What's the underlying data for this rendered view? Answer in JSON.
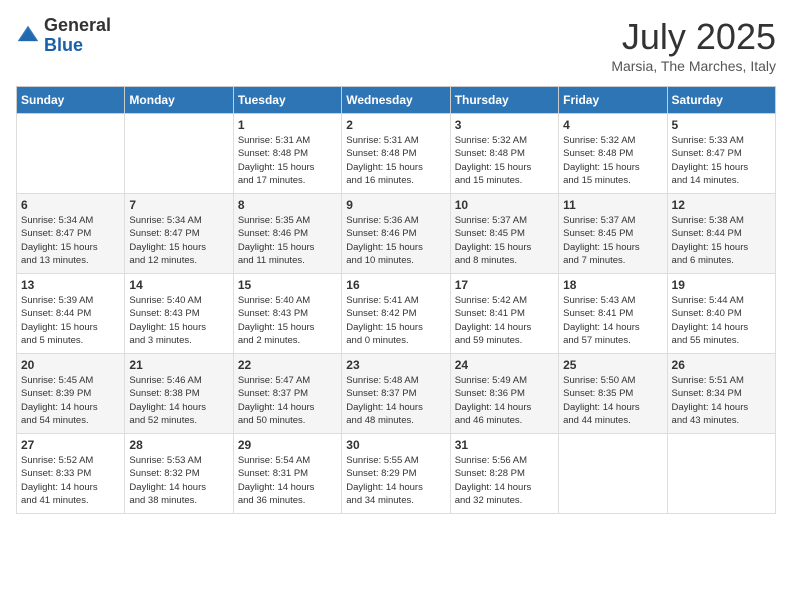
{
  "header": {
    "logo_general": "General",
    "logo_blue": "Blue",
    "month_title": "July 2025",
    "subtitle": "Marsia, The Marches, Italy"
  },
  "days_of_week": [
    "Sunday",
    "Monday",
    "Tuesday",
    "Wednesday",
    "Thursday",
    "Friday",
    "Saturday"
  ],
  "weeks": [
    [
      {
        "day": "",
        "info": ""
      },
      {
        "day": "",
        "info": ""
      },
      {
        "day": "1",
        "info": "Sunrise: 5:31 AM\nSunset: 8:48 PM\nDaylight: 15 hours\nand 17 minutes."
      },
      {
        "day": "2",
        "info": "Sunrise: 5:31 AM\nSunset: 8:48 PM\nDaylight: 15 hours\nand 16 minutes."
      },
      {
        "day": "3",
        "info": "Sunrise: 5:32 AM\nSunset: 8:48 PM\nDaylight: 15 hours\nand 15 minutes."
      },
      {
        "day": "4",
        "info": "Sunrise: 5:32 AM\nSunset: 8:48 PM\nDaylight: 15 hours\nand 15 minutes."
      },
      {
        "day": "5",
        "info": "Sunrise: 5:33 AM\nSunset: 8:47 PM\nDaylight: 15 hours\nand 14 minutes."
      }
    ],
    [
      {
        "day": "6",
        "info": "Sunrise: 5:34 AM\nSunset: 8:47 PM\nDaylight: 15 hours\nand 13 minutes."
      },
      {
        "day": "7",
        "info": "Sunrise: 5:34 AM\nSunset: 8:47 PM\nDaylight: 15 hours\nand 12 minutes."
      },
      {
        "day": "8",
        "info": "Sunrise: 5:35 AM\nSunset: 8:46 PM\nDaylight: 15 hours\nand 11 minutes."
      },
      {
        "day": "9",
        "info": "Sunrise: 5:36 AM\nSunset: 8:46 PM\nDaylight: 15 hours\nand 10 minutes."
      },
      {
        "day": "10",
        "info": "Sunrise: 5:37 AM\nSunset: 8:45 PM\nDaylight: 15 hours\nand 8 minutes."
      },
      {
        "day": "11",
        "info": "Sunrise: 5:37 AM\nSunset: 8:45 PM\nDaylight: 15 hours\nand 7 minutes."
      },
      {
        "day": "12",
        "info": "Sunrise: 5:38 AM\nSunset: 8:44 PM\nDaylight: 15 hours\nand 6 minutes."
      }
    ],
    [
      {
        "day": "13",
        "info": "Sunrise: 5:39 AM\nSunset: 8:44 PM\nDaylight: 15 hours\nand 5 minutes."
      },
      {
        "day": "14",
        "info": "Sunrise: 5:40 AM\nSunset: 8:43 PM\nDaylight: 15 hours\nand 3 minutes."
      },
      {
        "day": "15",
        "info": "Sunrise: 5:40 AM\nSunset: 8:43 PM\nDaylight: 15 hours\nand 2 minutes."
      },
      {
        "day": "16",
        "info": "Sunrise: 5:41 AM\nSunset: 8:42 PM\nDaylight: 15 hours\nand 0 minutes."
      },
      {
        "day": "17",
        "info": "Sunrise: 5:42 AM\nSunset: 8:41 PM\nDaylight: 14 hours\nand 59 minutes."
      },
      {
        "day": "18",
        "info": "Sunrise: 5:43 AM\nSunset: 8:41 PM\nDaylight: 14 hours\nand 57 minutes."
      },
      {
        "day": "19",
        "info": "Sunrise: 5:44 AM\nSunset: 8:40 PM\nDaylight: 14 hours\nand 55 minutes."
      }
    ],
    [
      {
        "day": "20",
        "info": "Sunrise: 5:45 AM\nSunset: 8:39 PM\nDaylight: 14 hours\nand 54 minutes."
      },
      {
        "day": "21",
        "info": "Sunrise: 5:46 AM\nSunset: 8:38 PM\nDaylight: 14 hours\nand 52 minutes."
      },
      {
        "day": "22",
        "info": "Sunrise: 5:47 AM\nSunset: 8:37 PM\nDaylight: 14 hours\nand 50 minutes."
      },
      {
        "day": "23",
        "info": "Sunrise: 5:48 AM\nSunset: 8:37 PM\nDaylight: 14 hours\nand 48 minutes."
      },
      {
        "day": "24",
        "info": "Sunrise: 5:49 AM\nSunset: 8:36 PM\nDaylight: 14 hours\nand 46 minutes."
      },
      {
        "day": "25",
        "info": "Sunrise: 5:50 AM\nSunset: 8:35 PM\nDaylight: 14 hours\nand 44 minutes."
      },
      {
        "day": "26",
        "info": "Sunrise: 5:51 AM\nSunset: 8:34 PM\nDaylight: 14 hours\nand 43 minutes."
      }
    ],
    [
      {
        "day": "27",
        "info": "Sunrise: 5:52 AM\nSunset: 8:33 PM\nDaylight: 14 hours\nand 41 minutes."
      },
      {
        "day": "28",
        "info": "Sunrise: 5:53 AM\nSunset: 8:32 PM\nDaylight: 14 hours\nand 38 minutes."
      },
      {
        "day": "29",
        "info": "Sunrise: 5:54 AM\nSunset: 8:31 PM\nDaylight: 14 hours\nand 36 minutes."
      },
      {
        "day": "30",
        "info": "Sunrise: 5:55 AM\nSunset: 8:29 PM\nDaylight: 14 hours\nand 34 minutes."
      },
      {
        "day": "31",
        "info": "Sunrise: 5:56 AM\nSunset: 8:28 PM\nDaylight: 14 hours\nand 32 minutes."
      },
      {
        "day": "",
        "info": ""
      },
      {
        "day": "",
        "info": ""
      }
    ]
  ]
}
